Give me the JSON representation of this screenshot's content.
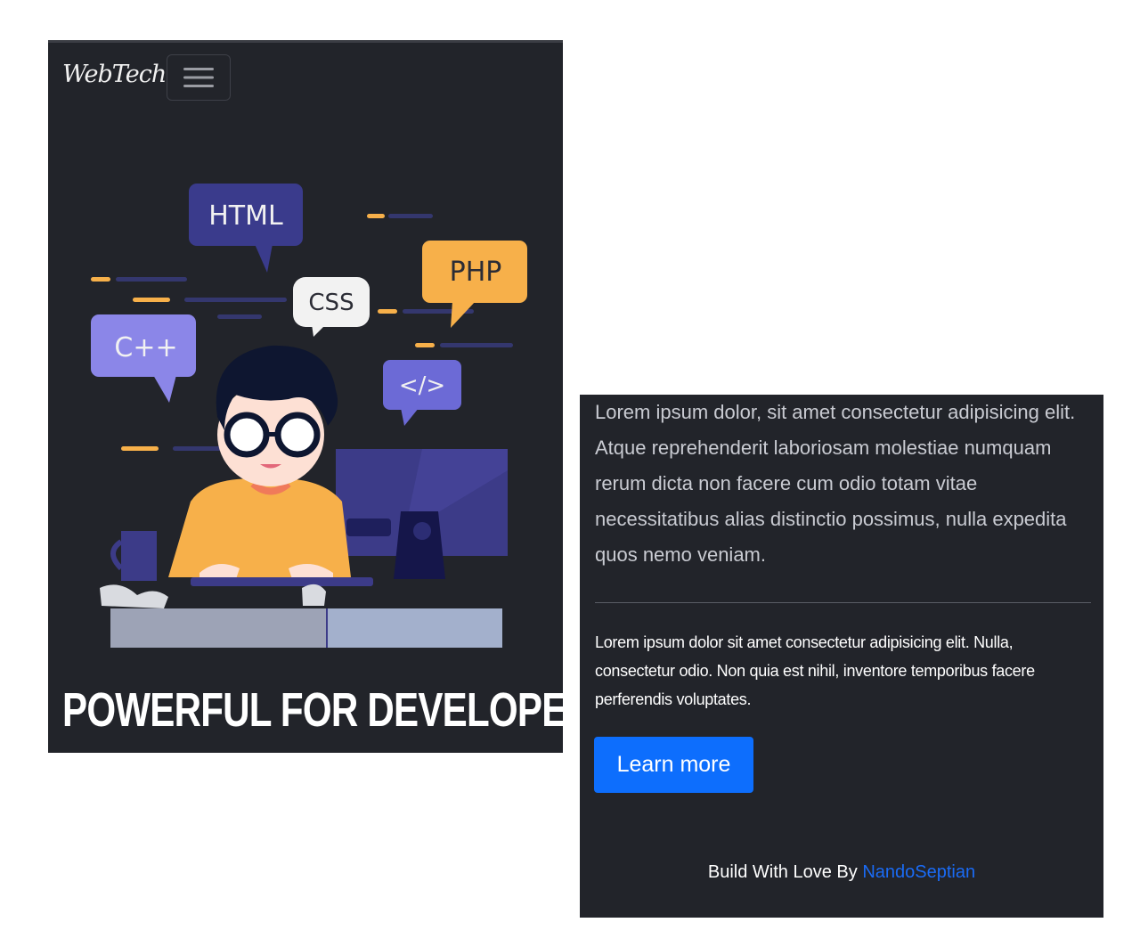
{
  "navbar": {
    "brand": "WebTech",
    "toggle_icon": "hamburger-menu-icon"
  },
  "illustration": {
    "bubbles": {
      "html": "HTML",
      "css": "CSS",
      "php": "PHP",
      "cpp": "C++",
      "code": "</>"
    }
  },
  "hero": {
    "headline": "POWERFUL FOR DEVELOPER!"
  },
  "content": {
    "lead": "Lorem ipsum dolor, sit amet consectetur adipisicing elit. Atque reprehenderit laboriosam molestiae numquam rerum dicta non facere cum odio totam vitae necessitatibus alias distinctio possimus, nulla expedita quos nemo veniam.",
    "body": "Lorem ipsum dolor sit amet consectetur adipisicing elit. Nulla, consectetur odio. Non quia est nihil, inventore temporibus facere perferendis voluptates.",
    "button_label": "Learn more"
  },
  "footer": {
    "prefix": "Build With Love By",
    "author": "NandoSeptian"
  },
  "colors": {
    "background": "#22242a",
    "accent": "#0d6efd",
    "bubble_purple": "#3a3b8c",
    "bubble_orange": "#f7b04a",
    "bubble_lilac": "#8b86e8"
  }
}
